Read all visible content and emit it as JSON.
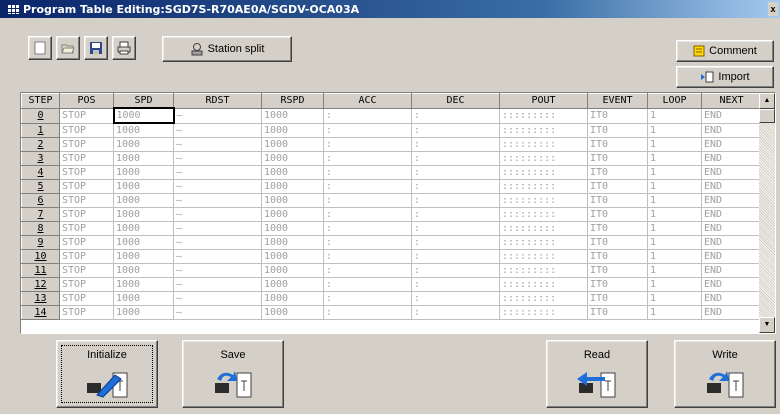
{
  "window": {
    "title": "Program Table Editing:SGD7S-R70AE0A/SGDV-OCA03A",
    "close_glyph": "x"
  },
  "toolbar": {
    "icons": [
      "new-file-icon",
      "open-folder-icon",
      "save-disk-icon",
      "print-icon"
    ],
    "station_split_label": "Station split",
    "comment_label": "Comment",
    "import_label": "Import"
  },
  "table": {
    "columns": [
      "STEP",
      "POS",
      "SPD",
      "RDST",
      "RSPD",
      "ACC",
      "DEC",
      "POUT",
      "EVENT",
      "LOOP",
      "NEXT"
    ],
    "rows": [
      [
        "0",
        "STOP",
        "1000",
        "–",
        "1000",
        ":",
        ":",
        ":::::::::",
        "IT0",
        "1",
        "END"
      ],
      [
        "1",
        "STOP",
        "1000",
        "–",
        "1000",
        ":",
        ":",
        ":::::::::",
        "IT0",
        "1",
        "END"
      ],
      [
        "2",
        "STOP",
        "1000",
        "–",
        "1000",
        ":",
        ":",
        ":::::::::",
        "IT0",
        "1",
        "END"
      ],
      [
        "3",
        "STOP",
        "1000",
        "–",
        "1000",
        ":",
        ":",
        ":::::::::",
        "IT0",
        "1",
        "END"
      ],
      [
        "4",
        "STOP",
        "1000",
        "–",
        "1000",
        ":",
        ":",
        ":::::::::",
        "IT0",
        "1",
        "END"
      ],
      [
        "5",
        "STOP",
        "1000",
        "–",
        "1000",
        ":",
        ":",
        ":::::::::",
        "IT0",
        "1",
        "END"
      ],
      [
        "6",
        "STOP",
        "1000",
        "–",
        "1000",
        ":",
        ":",
        ":::::::::",
        "IT0",
        "1",
        "END"
      ],
      [
        "7",
        "STOP",
        "1000",
        "–",
        "1000",
        ":",
        ":",
        ":::::::::",
        "IT0",
        "1",
        "END"
      ],
      [
        "8",
        "STOP",
        "1000",
        "–",
        "1000",
        ":",
        ":",
        ":::::::::",
        "IT0",
        "1",
        "END"
      ],
      [
        "9",
        "STOP",
        "1000",
        "–",
        "1000",
        ":",
        ":",
        ":::::::::",
        "IT0",
        "1",
        "END"
      ],
      [
        "10",
        "STOP",
        "1000",
        "–",
        "1000",
        ":",
        ":",
        ":::::::::",
        "IT0",
        "1",
        "END"
      ],
      [
        "11",
        "STOP",
        "1000",
        "–",
        "1000",
        ":",
        ":",
        ":::::::::",
        "IT0",
        "1",
        "END"
      ],
      [
        "12",
        "STOP",
        "1000",
        "–",
        "1000",
        ":",
        ":",
        ":::::::::",
        "IT0",
        "1",
        "END"
      ],
      [
        "13",
        "STOP",
        "1000",
        "–",
        "1000",
        ":",
        ":",
        ":::::::::",
        "IT0",
        "1",
        "END"
      ],
      [
        "14",
        "STOP",
        "1000",
        "–",
        "1000",
        ":",
        ":",
        ":::::::::",
        "IT0",
        "1",
        "END"
      ]
    ],
    "selected_row": 0,
    "selected_col": 2
  },
  "actions": {
    "initialize_label": "Initialize",
    "save_label": "Save",
    "read_label": "Read",
    "write_label": "Write"
  },
  "colors": {
    "title_bar": "#0a246a",
    "face": "#d4d0c8",
    "arrow_blue": "#1e6fd9"
  }
}
